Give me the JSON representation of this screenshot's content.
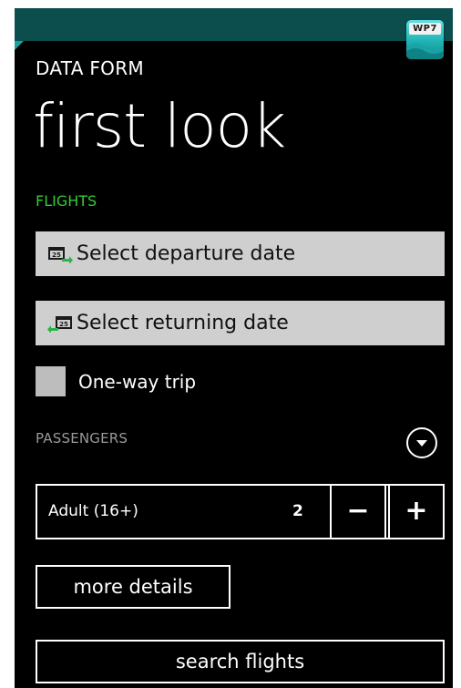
{
  "header": {
    "app_title": "DATA FORM",
    "page_title": "first look",
    "badge_text": "WP7"
  },
  "flights": {
    "section_label": "FLIGHTS",
    "departure_label": "Select departure date",
    "return_label": "Select returning date",
    "one_way_label": "One-way trip",
    "one_way_checked": false
  },
  "passengers": {
    "section_label": "PASSENGERS",
    "type_label": "Adult (16+)",
    "count": "2",
    "minus_label": "−",
    "plus_label": "+"
  },
  "actions": {
    "more_details_label": "more details",
    "search_label": "search flights"
  },
  "icons": {
    "departure": "calendar-depart-icon",
    "return": "calendar-return-icon",
    "expand": "chevron-down-circle-icon"
  },
  "colors": {
    "accent_green": "#33cc33",
    "topbar": "#0c4d4e",
    "field_bg": "#cfcfcf",
    "background": "#000000"
  }
}
